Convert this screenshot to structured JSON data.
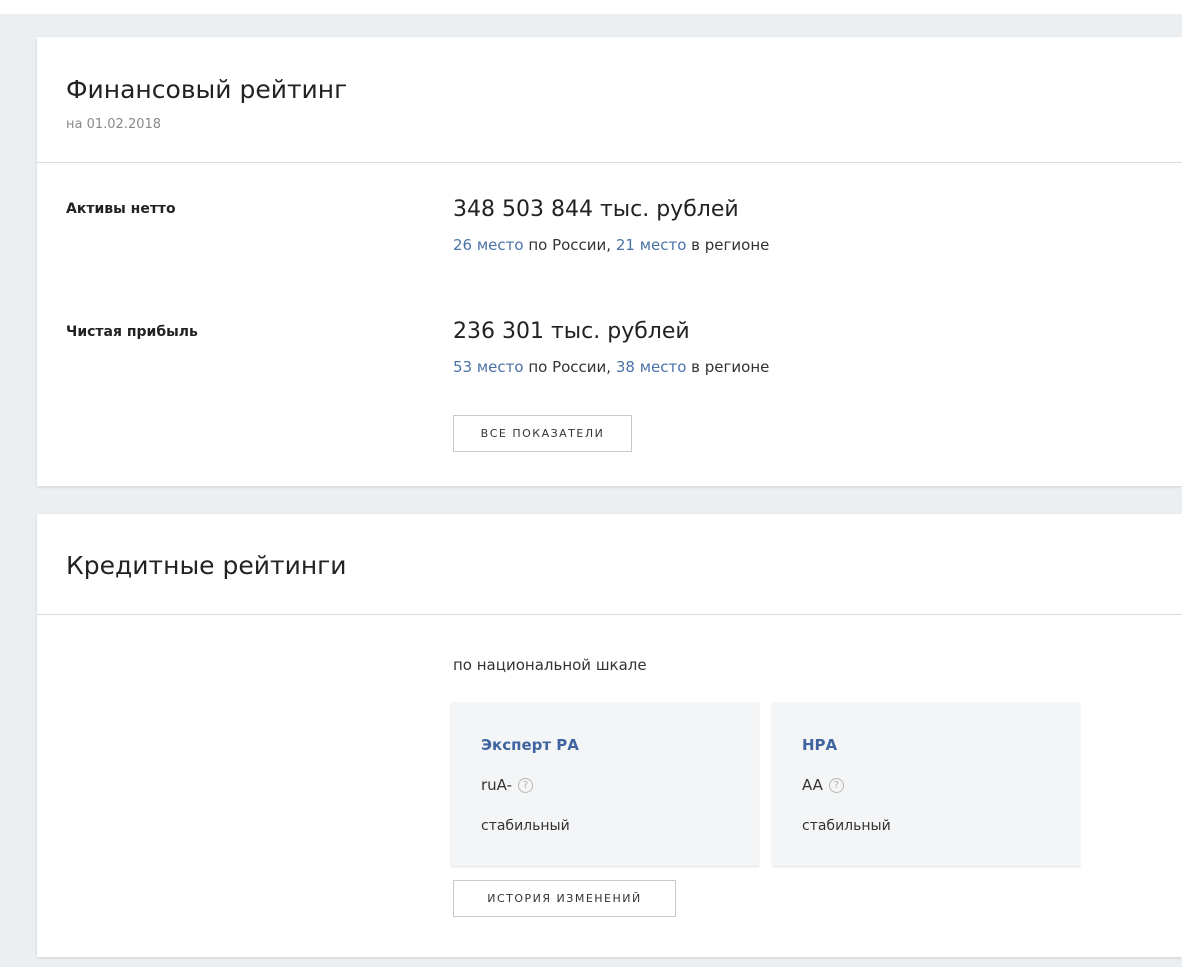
{
  "financial": {
    "title": "Финансовый рейтинг",
    "date": "на 01.02.2018",
    "metrics": [
      {
        "label": "Активы нетто",
        "value": "348 503 844 тыс. рублей",
        "russia_rank": "26 место",
        "russia_text": " по России, ",
        "region_rank": "21 место",
        "region_text": " в регионе"
      },
      {
        "label": "Чистая прибыль",
        "value": "236 301 тыс. рублей",
        "russia_rank": "53 место",
        "russia_text": " по России, ",
        "region_rank": "38 место",
        "region_text": " в регионе"
      }
    ],
    "all_button": "ВСЕ ПОКАЗАТЕЛИ"
  },
  "credit": {
    "title": "Кредитные рейтинги",
    "scale_label": "по национальной шкале",
    "agencies": [
      {
        "name": "Эксперт РА",
        "rating": "ruA-",
        "outlook": "стабильный",
        "help_icon": "question-circle-icon"
      },
      {
        "name": "НРА",
        "rating": "AA",
        "outlook": "стабильный",
        "help_icon": "question-circle-icon"
      }
    ],
    "history_button": "ИСТОРИЯ ИЗМЕНЕНИЙ"
  },
  "colors": {
    "background": "#eceff1",
    "link": "#4a72a8",
    "agency_link": "#3f64a0",
    "subtitle": "#8a8a8a"
  }
}
